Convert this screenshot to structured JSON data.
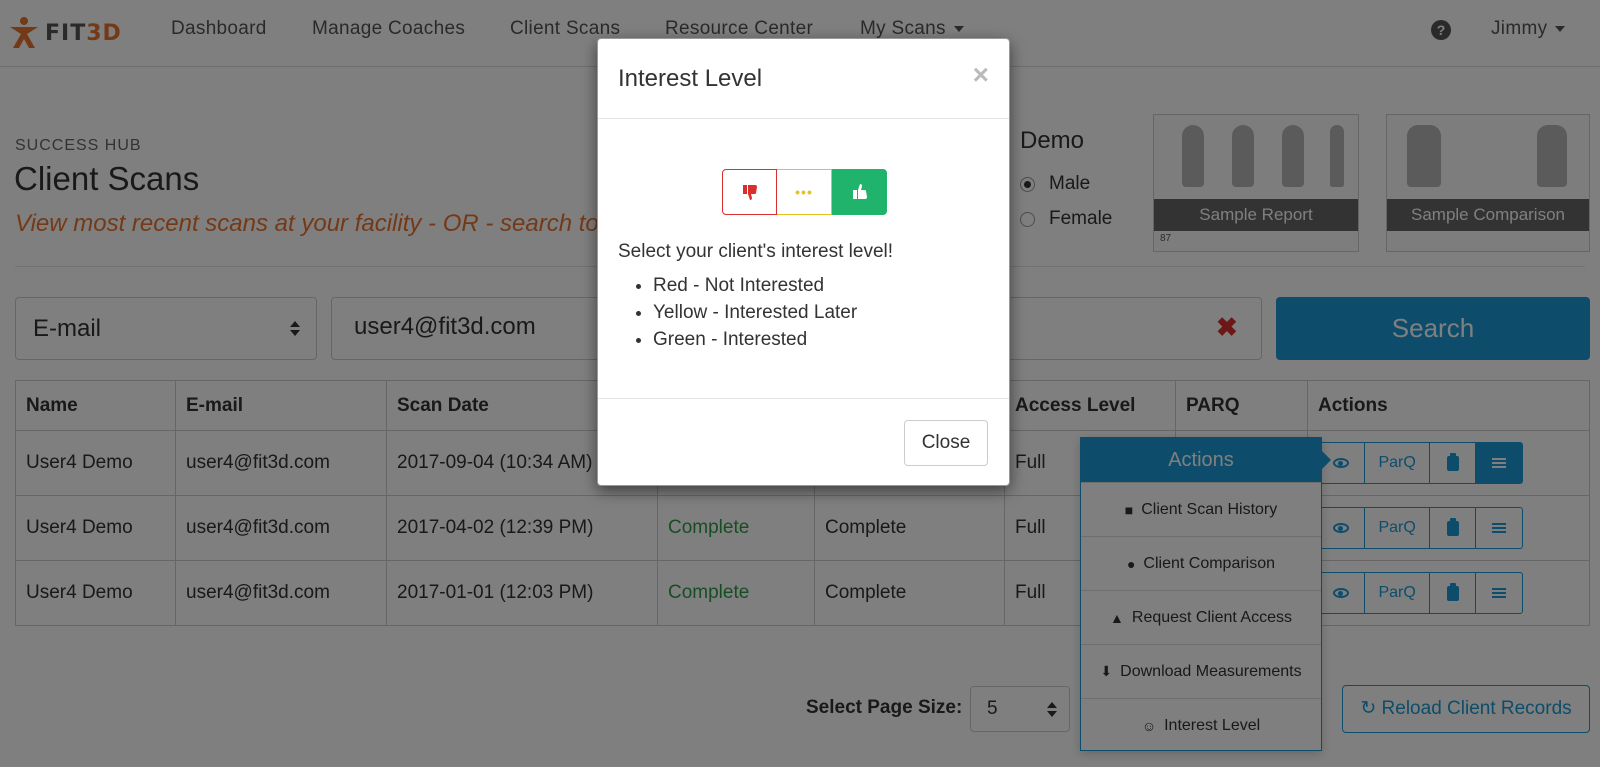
{
  "navbar": {
    "logo_prefix": "FIT",
    "logo_suffix": "3D",
    "items": [
      "Dashboard",
      "Manage Coaches",
      "Client Scans",
      "Resource Center",
      "My Scans"
    ],
    "help": "?",
    "user": "Jimmy"
  },
  "header": {
    "hub_label": "SUCCESS HUB",
    "title": "Client Scans",
    "subtitle": "View most recent scans at your facility - OR - search to"
  },
  "demo": {
    "label": "Demo",
    "options": [
      "Male",
      "Female"
    ],
    "selected": "Male"
  },
  "samples": {
    "report": "Sample Report",
    "report_number": "87",
    "comparison": "Sample Comparison"
  },
  "search": {
    "field_type": "E-mail",
    "query": "user4@fit3d.com",
    "clear_icon": "✖",
    "button": "Search"
  },
  "table": {
    "headers": [
      "Name",
      "E-mail",
      "Scan Date",
      "",
      "",
      "Access Level",
      "PARQ",
      "Actions"
    ],
    "rows": [
      {
        "name": "User4 Demo",
        "email": "user4@fit3d.com",
        "date": "2017-09-04 (10:34 AM)",
        "status1": "",
        "status2": "",
        "access": "Full"
      },
      {
        "name": "User4 Demo",
        "email": "user4@fit3d.com",
        "date": "2017-04-02 (12:39 PM)",
        "status1": "Complete",
        "status2": "Complete",
        "access": "Full"
      },
      {
        "name": "User4 Demo",
        "email": "user4@fit3d.com",
        "date": "2017-01-01 (12:03 PM)",
        "status1": "Complete",
        "status2": "Complete",
        "access": "Full"
      }
    ],
    "parq_label": "ParQ"
  },
  "actions_popover": {
    "title": "Actions",
    "items": [
      "Client Scan History",
      "Client Comparison",
      "Request Client Access",
      "Download Measurements",
      "Interest Level"
    ]
  },
  "pagination": {
    "label": "Select Page Size:",
    "value": "5",
    "reload": "Reload Client Records"
  },
  "modal": {
    "title": "Interest Level",
    "close_x": "×",
    "prompt": "Select your client's interest level!",
    "levels": [
      "Red - Not Interested",
      "Yellow - Interested Later",
      "Green - Interested"
    ],
    "dots": "•••",
    "close_button": "Close"
  },
  "colors": {
    "accent": "#1a9bd6",
    "brand": "#e8732f",
    "red": "#d9302f",
    "yellow": "#e7c11f",
    "green": "#1fb36b",
    "complete": "#2e9b48"
  }
}
